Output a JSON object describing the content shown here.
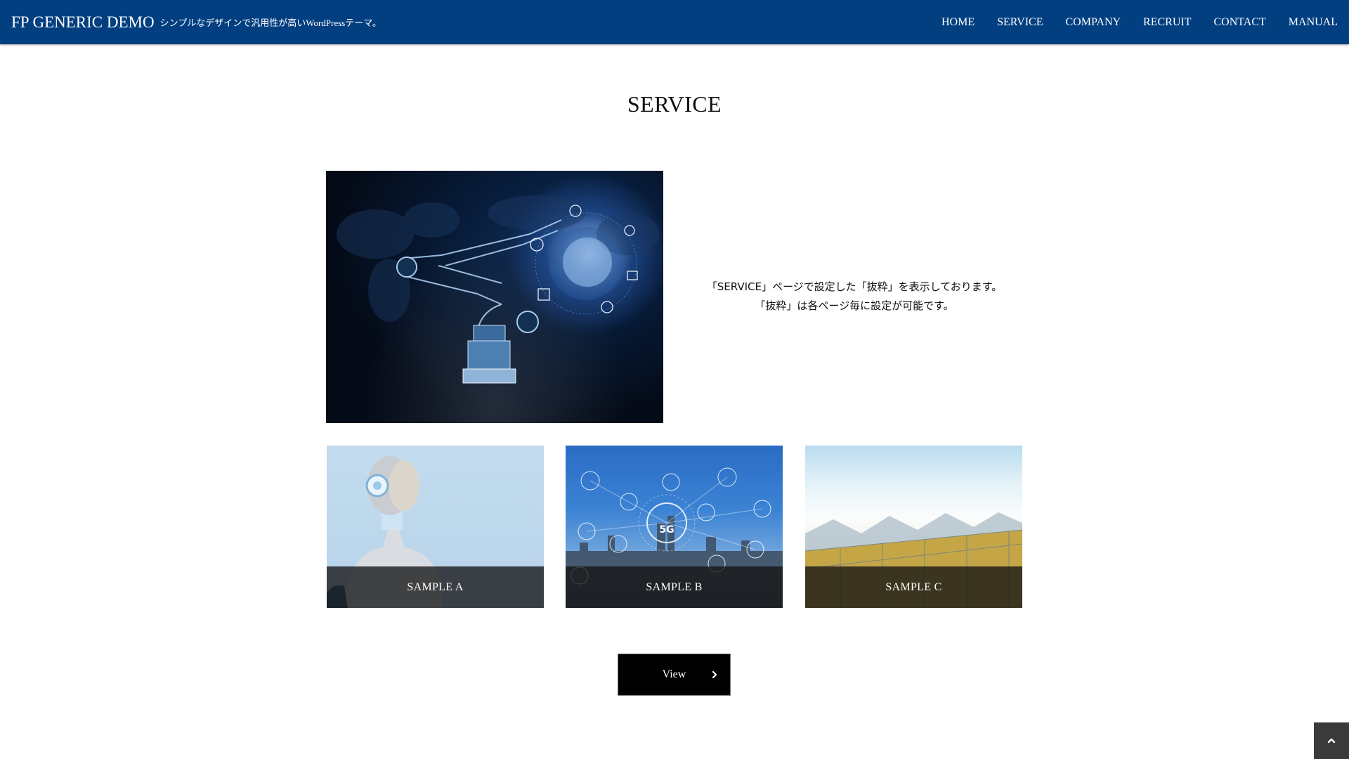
{
  "header": {
    "site_title": "FP GENERIC DEMO",
    "tagline": "シンプルなデザインで汎用性が高いWordPressテーマ。",
    "background_color": "#013f80",
    "nav": [
      {
        "label": "HOME"
      },
      {
        "label": "SERVICE"
      },
      {
        "label": "COMPANY"
      },
      {
        "label": "RECRUIT"
      },
      {
        "label": "CONTACT"
      },
      {
        "label": "MANUAL"
      }
    ]
  },
  "section": {
    "title": "SERVICE",
    "feature": {
      "image_alt": "robot-arm-ai-image",
      "excerpt_lines": [
        "「SERVICE」ページで設定した「抜粋」を表示しております。",
        "「抜粋」は各ページ毎に設定が可能です。"
      ]
    },
    "cards": [
      {
        "label": "SAMPLE A",
        "image": "humanoid-robot-image"
      },
      {
        "label": "SAMPLE B",
        "image": "5g-network-city-image"
      },
      {
        "label": "SAMPLE C",
        "image": "greenhouse-image"
      }
    ],
    "view_button": {
      "label": "View",
      "icon": "chevron-right-icon"
    }
  },
  "scroll_top": {
    "icon": "chevron-up-icon"
  }
}
